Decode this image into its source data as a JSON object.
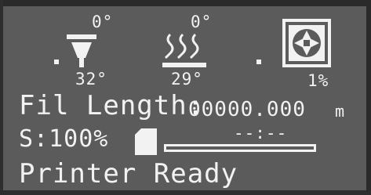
{
  "status_area": {
    "hotend": {
      "target": "0°",
      "current": "32°",
      "icon": "hotend-nozzle-icon"
    },
    "bed": {
      "target": "0°",
      "current": "29°",
      "icon": "heated-bed-icon"
    },
    "fan": {
      "speed": "1%",
      "icon": "fan-icon"
    }
  },
  "filament": {
    "label": "Fil Length:",
    "value": "00000.000",
    "unit": "m"
  },
  "speed": {
    "text": "S:100%"
  },
  "sd_card": {
    "icon": "sd-card-icon",
    "progress_fraction": 0,
    "time": "--:--"
  },
  "status_message": "Printer Ready",
  "colors": {
    "lcd_background": "#5b5b5b",
    "lcd_foreground": "#f2f2f2"
  }
}
